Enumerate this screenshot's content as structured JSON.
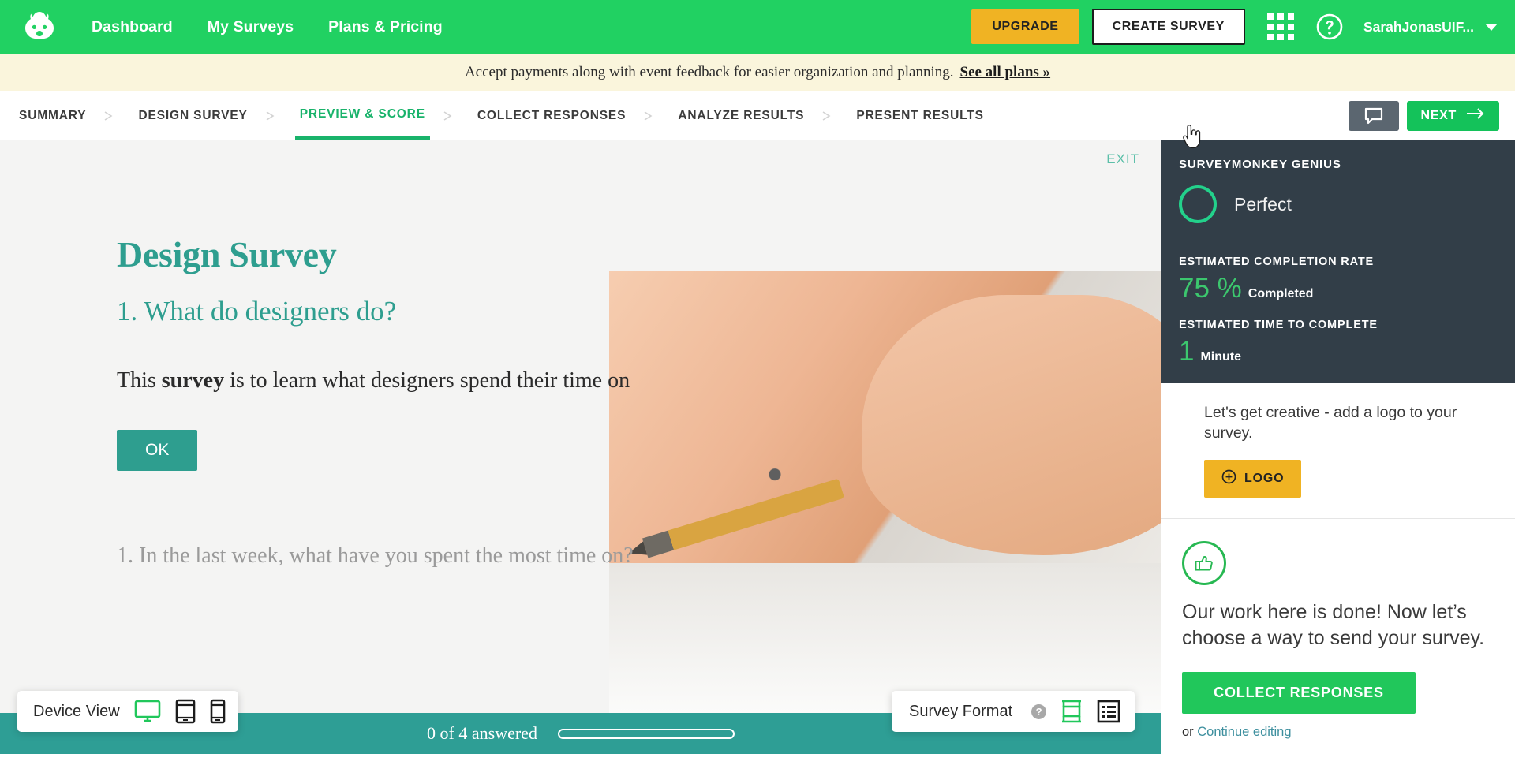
{
  "topnav": {
    "logo_name": "surveymonkey-logo",
    "links": [
      {
        "label": "Dashboard"
      },
      {
        "label": "My Surveys"
      },
      {
        "label": "Plans & Pricing"
      }
    ],
    "upgrade_label": "UPGRADE",
    "create_survey_label": "CREATE SURVEY",
    "apps_icon": "grid-apps-icon",
    "help_icon": "help-question-icon",
    "user_name": "SarahJonasUIF...",
    "caret_icon": "chevron-down-icon",
    "bg_color": "#21d162",
    "upgrade_color": "#f0b323"
  },
  "promo": {
    "text": "Accept payments along with event feedback for easier organization and planning.",
    "link_label": "See all plans »",
    "bg_color": "#faf5dc"
  },
  "tabbar": {
    "tabs": [
      {
        "label": "SUMMARY",
        "active": false
      },
      {
        "label": "DESIGN SURVEY",
        "active": false
      },
      {
        "label": "PREVIEW & SCORE",
        "active": true
      },
      {
        "label": "COLLECT RESPONSES",
        "active": false
      },
      {
        "label": "ANALYZE RESULTS",
        "active": false
      },
      {
        "label": "PRESENT RESULTS",
        "active": false
      }
    ],
    "separator": "›",
    "comment_icon": "comment-bubble-icon",
    "next_label": "NEXT",
    "next_icon": "arrow-right-icon",
    "active_color": "#19b36b"
  },
  "preview": {
    "exit_label": "EXIT",
    "survey_title": "Design Survey",
    "question_heading": "1. What do designers do?",
    "body_prefix": "This ",
    "body_bold": "survey",
    "body_suffix": " is to learn what designers spend their time on",
    "ok_label": "OK",
    "next_question": "1. In the last week, what have you spent the most time on?",
    "accent_color": "#2e9e8f"
  },
  "bottombar": {
    "progress_text": "0 of 4 answered",
    "progress_percent": 0,
    "bg_color": "#2e9e95"
  },
  "device_widget": {
    "label": "Device View",
    "options": [
      {
        "icon": "desktop-monitor-icon",
        "active": true
      },
      {
        "icon": "tablet-icon",
        "active": false
      },
      {
        "icon": "mobile-phone-icon",
        "active": false
      }
    ],
    "active_color": "#21c75b"
  },
  "format_widget": {
    "label": "Survey Format",
    "help_icon": "help-question-icon",
    "options": [
      {
        "icon": "one-question-at-a-time-icon",
        "active": true
      },
      {
        "icon": "all-questions-list-icon",
        "active": false
      }
    ]
  },
  "genius": {
    "title": "SURVEYMONKEY GENIUS",
    "score_ring_icon": "score-ring-icon",
    "score_label": "Perfect",
    "stats": [
      {
        "label": "ESTIMATED COMPLETION RATE",
        "value": "75 %",
        "unit": "Completed"
      },
      {
        "label": "ESTIMATED TIME TO COMPLETE",
        "value": "1",
        "unit": "Minute"
      }
    ],
    "bg_color": "#323e48",
    "accent_color": "#23d18b"
  },
  "logo_tip": {
    "text": "Let's get creative - add a logo to your survey.",
    "button_label": "LOGO",
    "button_icon": "plus-circle-icon",
    "button_color": "#f0b323"
  },
  "done_card": {
    "icon": "thumbs-up-icon",
    "text": "Our work here is done! Now let’s choose a way to send your survey.",
    "button_label": "COLLECT RESPONSES",
    "or_label": "or",
    "continue_label": "Continue editing",
    "button_color": "#21c75b"
  },
  "cursor": {
    "icon": "pointer-hand-cursor"
  }
}
